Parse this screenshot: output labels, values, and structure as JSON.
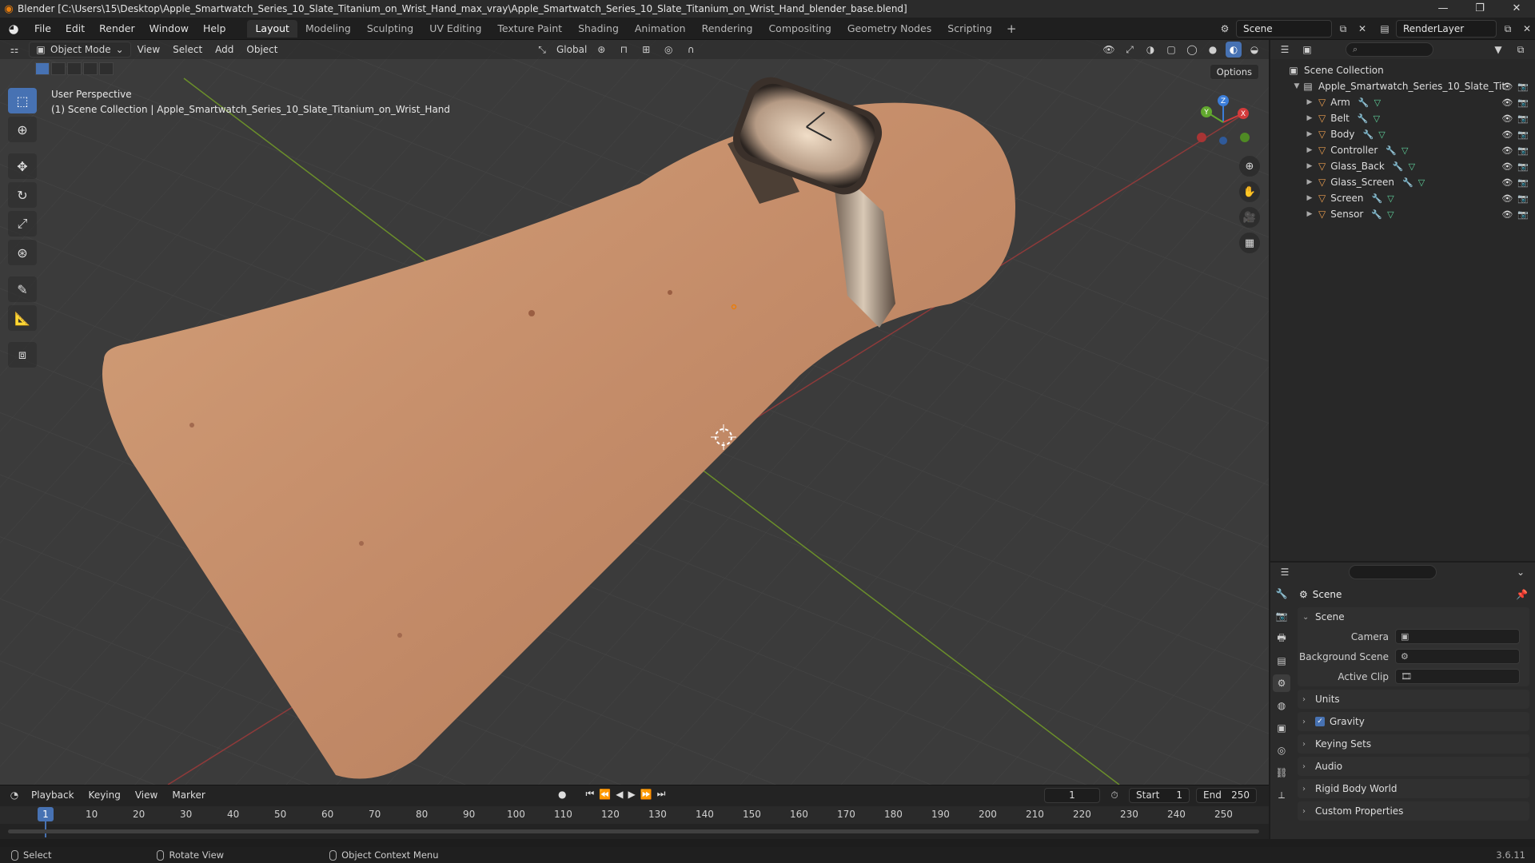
{
  "titlebar": {
    "title": "Blender [C:\\Users\\15\\Desktop\\Apple_Smartwatch_Series_10_Slate_Titanium_on_Wrist_Hand_max_vray\\Apple_Smartwatch_Series_10_Slate_Titanium_on_Wrist_Hand_blender_base.blend]",
    "minimize": "—",
    "maximize": "❐",
    "close": "✕"
  },
  "menubar": {
    "items": [
      "File",
      "Edit",
      "Render",
      "Window",
      "Help"
    ],
    "workspaces": [
      "Layout",
      "Modeling",
      "Sculpting",
      "UV Editing",
      "Texture Paint",
      "Shading",
      "Animation",
      "Rendering",
      "Compositing",
      "Geometry Nodes",
      "Scripting"
    ],
    "active_workspace": "Layout",
    "add": "+",
    "scene": "Scene",
    "view_layer": "RenderLayer"
  },
  "viewport": {
    "mode": "Object Mode",
    "menus": [
      "View",
      "Select",
      "Add",
      "Object"
    ],
    "transform_orientation": "Global",
    "options": "Options",
    "perspective": "User Perspective",
    "collection_path": "(1) Scene Collection | Apple_Smartwatch_Series_10_Slate_Titanium_on_Wrist_Hand",
    "gizmo": {
      "x": "X",
      "y": "Y",
      "z": "Z"
    }
  },
  "outliner": {
    "root": "Scene Collection",
    "collection": "Apple_Smartwatch_Series_10_Slate_Tit",
    "objects": [
      "Arm",
      "Belt",
      "Body",
      "Controller",
      "Glass_Back",
      "Glass_Screen",
      "Screen",
      "Sensor"
    ]
  },
  "properties": {
    "context": "Scene",
    "panel_scene": "Scene",
    "camera_label": "Camera",
    "background_label": "Background Scene",
    "clip_label": "Active Clip",
    "panels": [
      "Units",
      "Gravity",
      "Keying Sets",
      "Audio",
      "Rigid Body World",
      "Custom Properties"
    ],
    "gravity_checked": true
  },
  "timeline": {
    "menus": [
      "Playback",
      "Keying",
      "View",
      "Marker"
    ],
    "current_frame": "1",
    "start_label": "Start",
    "start": "1",
    "end_label": "End",
    "end": "250",
    "ticks": [
      "10",
      "20",
      "30",
      "40",
      "50",
      "60",
      "70",
      "80",
      "90",
      "100",
      "110",
      "120",
      "130",
      "140",
      "150",
      "160",
      "170",
      "180",
      "190",
      "200",
      "210",
      "220",
      "230",
      "240",
      "250"
    ]
  },
  "statusbar": {
    "hints": [
      "Select",
      "Rotate View",
      "Object Context Menu"
    ],
    "version": "3.6.11"
  },
  "colors": {
    "accent": "#4772b3",
    "orange": "#e87d0d",
    "skin": "#c48c69"
  }
}
